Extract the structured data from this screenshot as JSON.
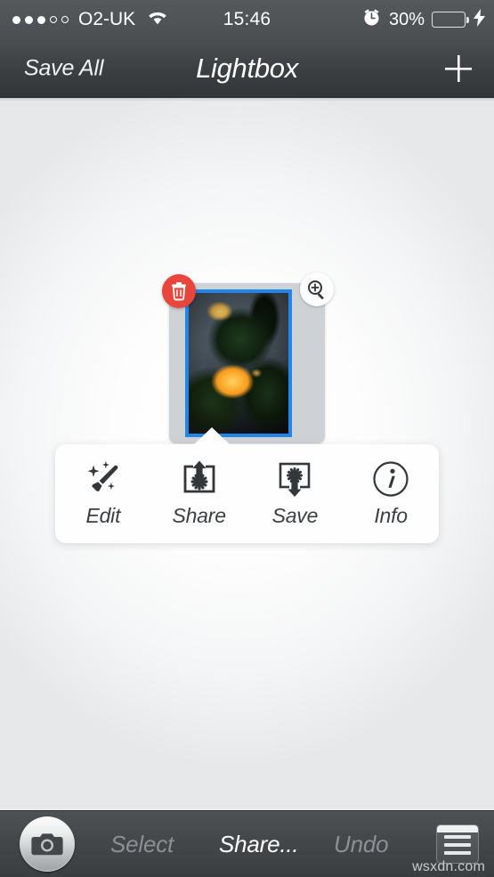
{
  "status_bar": {
    "signal_dots_filled": 3,
    "signal_dots_total": 5,
    "carrier": "O2-UK",
    "wifi_icon": "wifi-icon",
    "time": "15:46",
    "alarm_icon": "alarm-clock-icon",
    "battery_percent": "30%",
    "battery_level": 30,
    "battery_color": "#41d945",
    "charging_icon": "lightning-bolt-icon"
  },
  "nav_bar": {
    "left_button": "Save All",
    "title": "Lightbox",
    "right_button_icon": "plus-icon"
  },
  "canvas": {
    "thumbnail": {
      "delete_badge_icon": "trash-icon",
      "zoom_badge_icon": "magnify-plus-icon",
      "selection_border_color": "#2485e8",
      "card_color": "#cfd2d4",
      "photo_description": "yellow rose"
    },
    "popover": {
      "items": [
        {
          "label": "Edit",
          "icon": "magic-wand-icon"
        },
        {
          "label": "Share",
          "icon": "share-up-arrow-icon"
        },
        {
          "label": "Save",
          "icon": "save-down-arrow-icon"
        },
        {
          "label": "Info",
          "icon": "info-circle-icon"
        }
      ]
    }
  },
  "toolbar": {
    "camera_icon": "camera-icon",
    "select_label": "Select",
    "share_label": "Share...",
    "undo_label": "Undo",
    "menu_icon": "list-menu-icon"
  },
  "watermark": "wsxdn.com"
}
